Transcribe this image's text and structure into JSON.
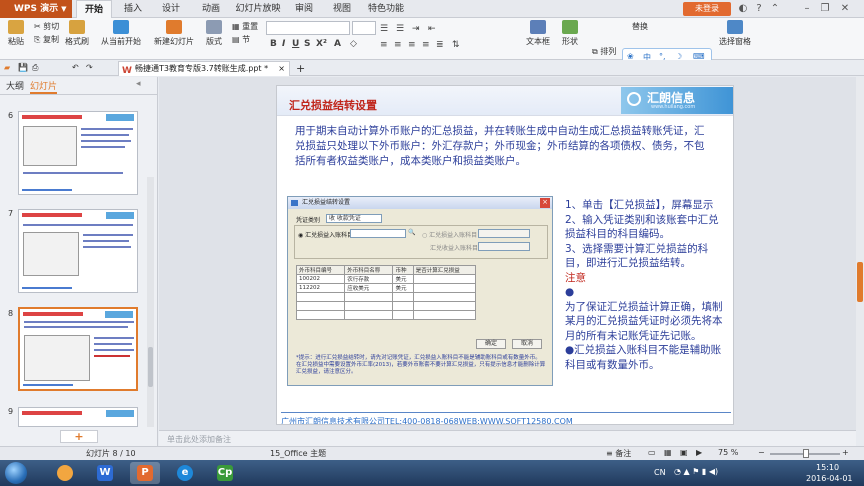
{
  "app": {
    "brand": "WPS 演示",
    "tabs": [
      "开始",
      "插入",
      "设计",
      "动画",
      "幻灯片放映",
      "审阅",
      "视图",
      "特色功能"
    ],
    "active_tab": "开始",
    "login": "未登录"
  },
  "ribbon": {
    "paste": "粘贴",
    "cut": "剪切",
    "copy": "复制",
    "format_painter": "格式刷",
    "from_current": "从当前开始",
    "new_slide": "新建幻灯片",
    "layout": "版式",
    "reset": "重置",
    "section": "节",
    "textbox": "文本框",
    "shape": "形状",
    "arrange": "排列",
    "replace": "替换",
    "select_pane": "选择窗格",
    "ime": [
      "中",
      "°,",
      "☽"
    ]
  },
  "doc": {
    "tab_title": "畅捷通T3教育专版3.7转账生成.ppt *"
  },
  "left_panel": {
    "tab_outline": "大纲",
    "tab_slides": "幻灯片",
    "slide_numbers": [
      "6",
      "7",
      "8",
      "9"
    ],
    "selected": "8"
  },
  "slide": {
    "title": "汇兑损益结转设置",
    "logo_text": "汇朗信息",
    "logo_sub": "www.huilang.com",
    "intro": "用于期末自动计算外币账户的汇总损益，并在转账生成中自动生成汇总损益转账凭证，汇兑损益只处理以下外币账户：外汇存款户；外币现金；外币结算的各项债权、债务，不包括所有者权益类账户，成本类账户和损益类账户。",
    "right_items": [
      "1、单击【汇兑损益】，屏幕显示",
      "2、输入凭证类别和该账套中汇兑损益科目的科目编码。",
      "3、选择需要计算汇兑损益的科目，即进行汇兑损益结转。"
    ],
    "note_label": "注意",
    "note_bullets": [
      "●",
      "为了保证汇兑损益计算正确，填制某月的汇兑损益凭证时必须先将本月的所有未记账凭证先记账。",
      "●汇兑损益入账科目不能是辅助账科目或有数量外币。"
    ],
    "footer": "广州市汇朗信息技术有限公司TEL:400-0818-068WEB:WWW.SOFT12580.COM"
  },
  "dialog": {
    "title": "汇兑损益结转设置",
    "voucher_type_label": "凭证类别",
    "voucher_type_value": "收  收款凭证",
    "in_account": "汇兑损益入账科目",
    "option_a": "汇兑损益入账科目",
    "option_b": "汇兑收益入账科目",
    "columns": [
      "外币科目编号",
      "外币科目名称",
      "币种",
      "是否计算汇兑损益"
    ],
    "rows": [
      [
        "100202",
        "农行存款",
        "美元",
        ""
      ],
      [
        "112202",
        "应收美元",
        "美元",
        ""
      ]
    ],
    "ok": "确定",
    "cancel": "取消",
    "note": "*提示：进行汇兑损益结转时，请先对记账凭证，汇兑损益入账科目不能是辅助账科目或有数量外币。在汇兑损益中需要设置外币汇率(2013)，若要外币账套不要计算汇兑损益，只有提示信息才能删除计算汇兑损益，请注意区分。"
  },
  "notes_placeholder": "单击此处添加备注",
  "status": {
    "slide_pos": "幻灯片 8 / 10",
    "theme": "15_Office 主题",
    "notes_btn": "备注",
    "zoom": "75 %"
  },
  "taskbar": {
    "time": "15:10",
    "date": "2016-04-01",
    "lang": "CN"
  },
  "colors": {
    "accent": "#c2521b",
    "slide_text": "#2c3e9a",
    "slide_title": "#c0261c"
  }
}
